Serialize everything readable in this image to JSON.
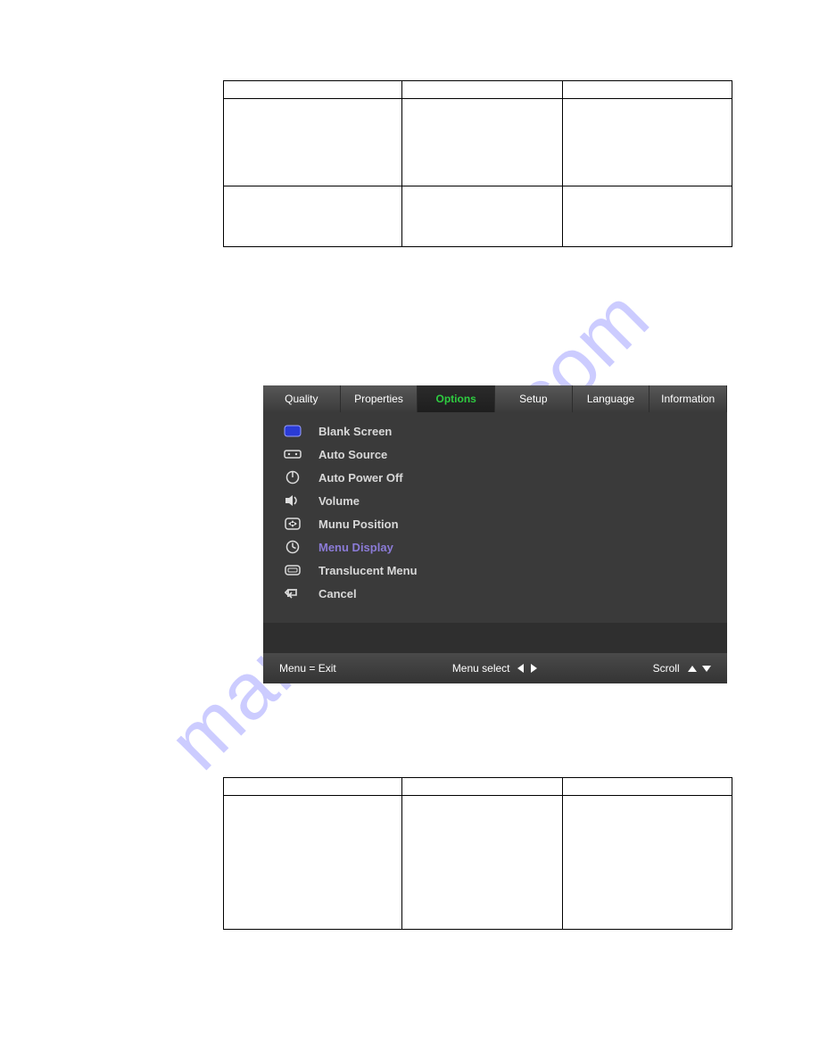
{
  "watermark": "manualshive.com",
  "table1": {
    "headers": [
      "",
      "",
      ""
    ],
    "rows": [
      [
        "",
        "",
        ""
      ],
      [
        "",
        "",
        ""
      ]
    ]
  },
  "table2": {
    "headers": [
      "",
      "",
      ""
    ],
    "rows": [
      [
        "",
        "",
        ""
      ]
    ]
  },
  "osd": {
    "tabs": [
      "Quality",
      "Properties",
      "Options",
      "Setup",
      "Language",
      "Information"
    ],
    "active_tab_index": 2,
    "items": [
      {
        "icon": "screen-icon",
        "label": "Blank Screen"
      },
      {
        "icon": "source-icon",
        "label": "Auto Source"
      },
      {
        "icon": "power-icon",
        "label": "Auto Power Off"
      },
      {
        "icon": "volume-icon",
        "label": "Volume"
      },
      {
        "icon": "position-icon",
        "label": "Munu Position"
      },
      {
        "icon": "timer-icon",
        "label": "Menu Display"
      },
      {
        "icon": "menu-icon",
        "label": "Translucent Menu"
      },
      {
        "icon": "cancel-icon",
        "label": "Cancel"
      }
    ],
    "selected_index": 5,
    "footer": {
      "left": "Menu = Exit",
      "mid": "Menu select",
      "right": "Scroll"
    }
  }
}
